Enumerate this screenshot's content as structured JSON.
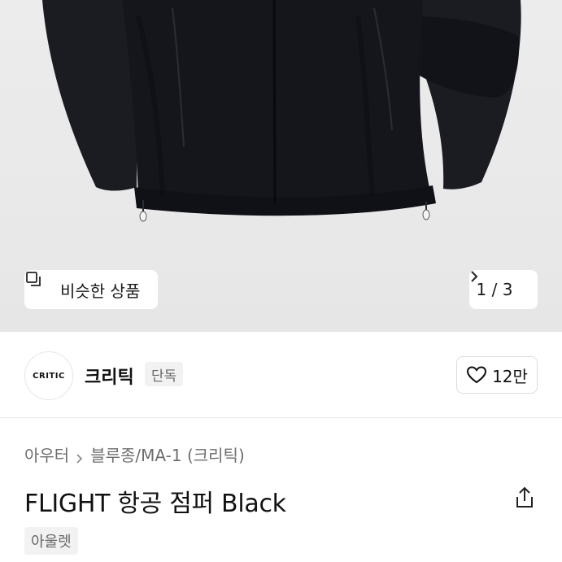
{
  "hero": {
    "similar_label": "비슷한 상품",
    "similar_icon": "similar-items-icon",
    "pager": {
      "current": "1",
      "separator": "/",
      "total": "3"
    },
    "pager_icon": "chevron-right-icon"
  },
  "brand": {
    "logo_text": "CRITIC",
    "name": "크리틱",
    "badge": "단독",
    "likes": "12만",
    "like_icon": "heart-outline-icon"
  },
  "product": {
    "breadcrumb": [
      "아우터",
      "블루종/MA-1 (크리틱)"
    ],
    "title": "FLIGHT 항공 점퍼 Black",
    "tag": "아울렛",
    "share_icon": "share-icon"
  },
  "colors": {
    "jacket": "#14161c",
    "hero_bg": "#ebebeb",
    "muted_text": "#6e6e6e",
    "badge_bg": "#f2f2f2"
  }
}
